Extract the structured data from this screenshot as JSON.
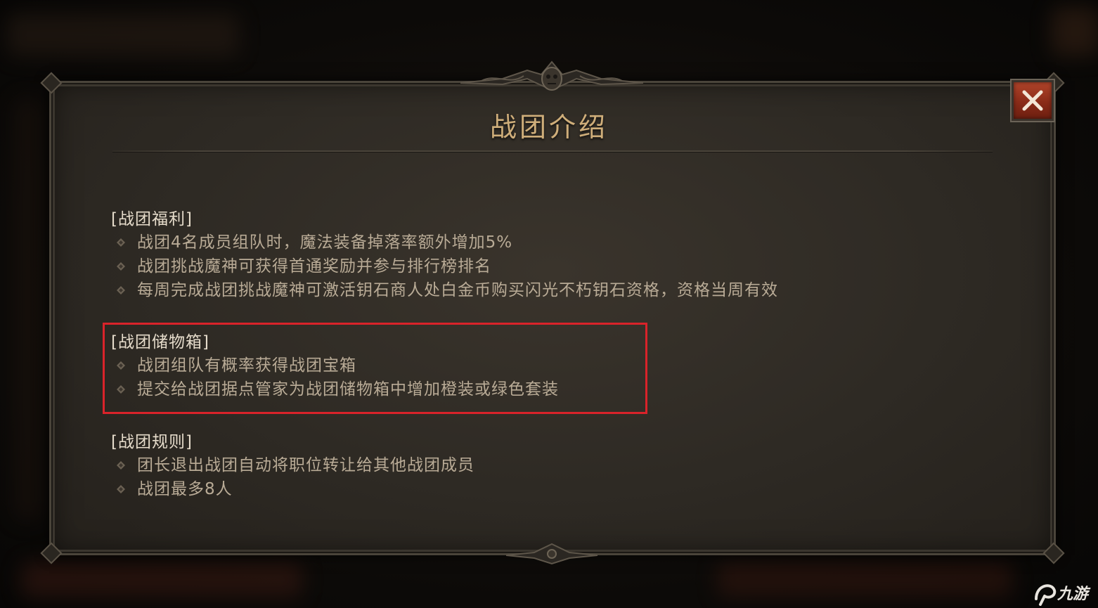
{
  "dialog": {
    "title": "战团介绍",
    "close_icon": "close-x-icon"
  },
  "sections": [
    {
      "heading": "[战团福利]",
      "items": [
        "战团4名成员组队时，魔法装备掉落率额外增加5%",
        "战团挑战魔神可获得首通奖励并参与排行榜排名",
        "每周完成战团挑战魔神可激活钥石商人处白金币购买闪光不朽钥石资格，资格当周有效"
      ]
    },
    {
      "heading": "[战团储物箱]",
      "items": [
        "战团组队有概率获得战团宝箱",
        "提交给战团据点管家为战团储物箱中增加橙装或绿色套装"
      ],
      "highlighted": true,
      "highlight_color": "#d9232a"
    },
    {
      "heading": "[战团规则]",
      "items": [
        "团长退出战团自动将职位转让给其他战团成员",
        "战团最多8人"
      ]
    }
  ],
  "watermark": {
    "text": "九游",
    "icon": "jiuyou-logo-icon"
  },
  "colors": {
    "title": "#cfae7a",
    "heading": "#e6dccb",
    "body": "#b9ab96",
    "close_button": "#9a3620",
    "panel": "#2e2a24"
  }
}
